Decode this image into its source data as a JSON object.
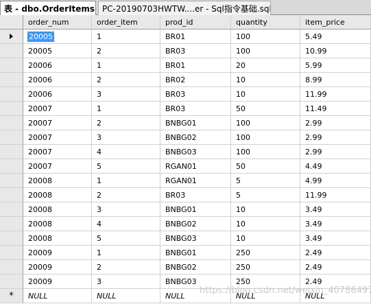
{
  "tabs": [
    {
      "label": "表 - dbo.OrderItems",
      "active": true
    },
    {
      "label": "PC-20190703HWTW....er - Sql指令基础.sql",
      "active": false
    }
  ],
  "grid": {
    "columns": [
      "order_num",
      "order_item",
      "prod_id",
      "quantity",
      "item_price"
    ],
    "rows": [
      [
        "20005",
        "1",
        "BR01",
        "100",
        "5.49"
      ],
      [
        "20005",
        "2",
        "BR03",
        "100",
        "10.99"
      ],
      [
        "20006",
        "1",
        "BR01",
        "20",
        "5.99"
      ],
      [
        "20006",
        "2",
        "BR02",
        "10",
        "8.99"
      ],
      [
        "20006",
        "3",
        "BR03",
        "10",
        "11.99"
      ],
      [
        "20007",
        "1",
        "BR03",
        "50",
        "11.49"
      ],
      [
        "20007",
        "2",
        "BNBG01",
        "100",
        "2.99"
      ],
      [
        "20007",
        "3",
        "BNBG02",
        "100",
        "2.99"
      ],
      [
        "20007",
        "4",
        "BNBG03",
        "100",
        "2.99"
      ],
      [
        "20007",
        "5",
        "RGAN01",
        "50",
        "4.49"
      ],
      [
        "20008",
        "1",
        "RGAN01",
        "5",
        "4.99"
      ],
      [
        "20008",
        "2",
        "BR03",
        "5",
        "11.99"
      ],
      [
        "20008",
        "3",
        "BNBG01",
        "10",
        "3.49"
      ],
      [
        "20008",
        "4",
        "BNBG02",
        "10",
        "3.49"
      ],
      [
        "20008",
        "5",
        "BNBG03",
        "10",
        "3.49"
      ],
      [
        "20009",
        "1",
        "BNBG01",
        "250",
        "2.49"
      ],
      [
        "20009",
        "2",
        "BNBG02",
        "250",
        "2.49"
      ],
      [
        "20009",
        "3",
        "BNBG03",
        "250",
        "2.49"
      ]
    ],
    "new_row": [
      "NULL",
      "NULL",
      "NULL",
      "NULL",
      "NULL"
    ],
    "new_row_marker": "*",
    "current_row_marker_icon": "row-pointer-icon"
  },
  "watermark": "https://blog.csdn.net/weixin_40786497",
  "colors": {
    "selection": "#3399ff",
    "header_bg": "#e8e8e8",
    "tabbar_bg": "#d9d9d9"
  }
}
